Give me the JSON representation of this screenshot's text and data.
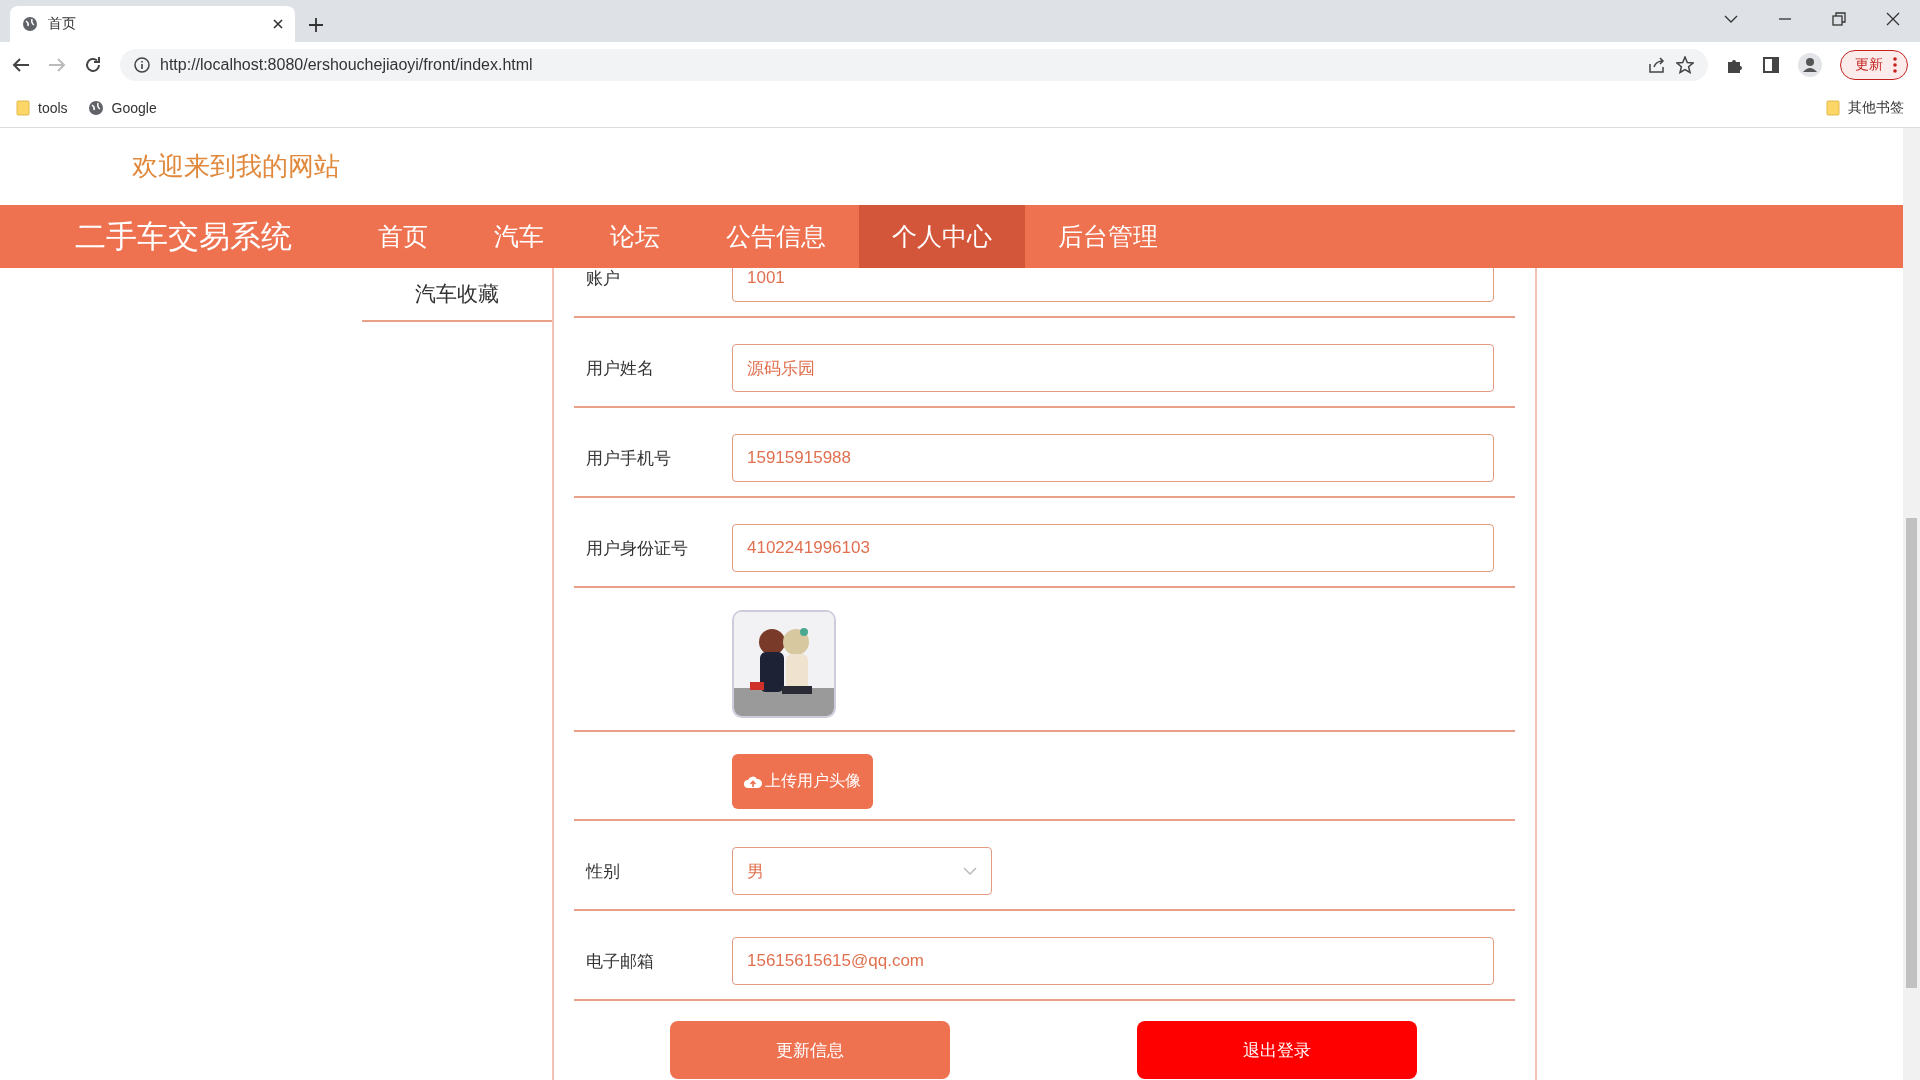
{
  "browser": {
    "tab_title": "首页",
    "url": "http://localhost:8080/ershouchejiaoyi/front/index.html",
    "bookmarks": [
      {
        "label": "tools",
        "kind": "folder"
      },
      {
        "label": "Google",
        "kind": "site"
      }
    ],
    "other_bookmarks": "其他书签",
    "update_button": "更新"
  },
  "welcome": "欢迎来到我的网站",
  "nav": {
    "brand": "二手车交易系统",
    "items": [
      {
        "label": "首页",
        "selected": false
      },
      {
        "label": "汽车",
        "selected": false
      },
      {
        "label": "论坛",
        "selected": false
      },
      {
        "label": "公告信息",
        "selected": false
      },
      {
        "label": "个人中心",
        "selected": true
      },
      {
        "label": "后台管理",
        "selected": false
      }
    ]
  },
  "sidebar": {
    "items": [
      {
        "label": "汽车收藏"
      }
    ]
  },
  "form": {
    "fields": [
      {
        "kind": "text",
        "label": "账户",
        "value": "1001"
      },
      {
        "kind": "text",
        "label": "用户姓名",
        "value": "源码乐园"
      },
      {
        "kind": "text",
        "label": "用户手机号",
        "value": "15915915988"
      },
      {
        "kind": "text",
        "label": "用户身份证号",
        "value": "4102241996103"
      },
      {
        "kind": "avatar"
      },
      {
        "kind": "upload",
        "button": "上传用户头像"
      },
      {
        "kind": "select",
        "label": "性别",
        "value": "男"
      },
      {
        "kind": "text",
        "label": "电子邮箱",
        "value": "15615615615@qq.com"
      }
    ],
    "buttons": [
      {
        "label": "更新信息",
        "kind": "primary"
      },
      {
        "label": "退出登录",
        "kind": "danger"
      }
    ]
  }
}
